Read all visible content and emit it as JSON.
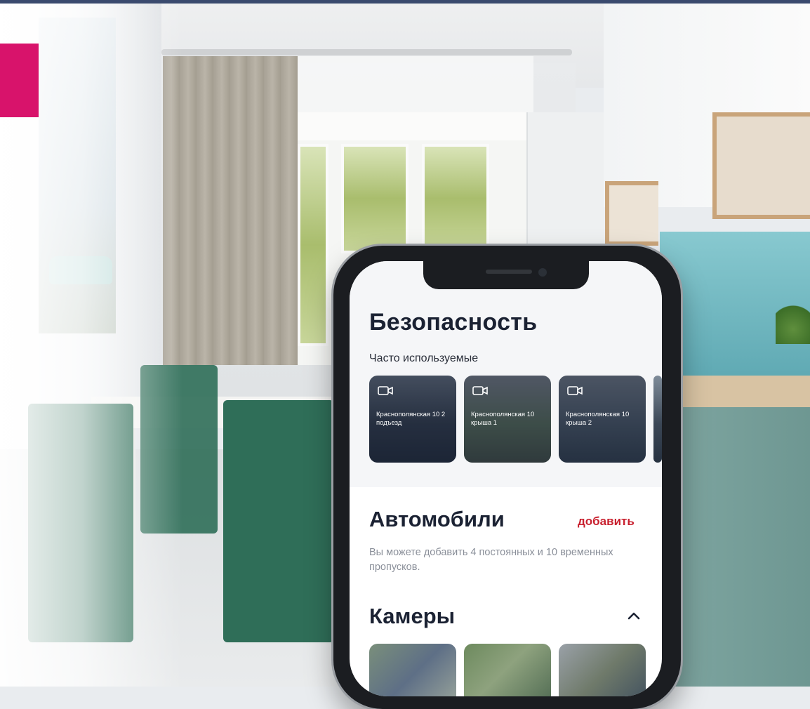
{
  "app": {
    "accent_color": "#c8202e",
    "badge_color": "#d8136b"
  },
  "security": {
    "title": "Безопасность",
    "frequent_label": "Часто используемые",
    "cameras": [
      {
        "label": "Краснополянская 10 2 подъезд",
        "icon": "video-camera-icon"
      },
      {
        "label": "Краснополянская 10 крыша 1",
        "icon": "video-camera-icon"
      },
      {
        "label": "Краснополянская 10 крыша 2",
        "icon": "video-camera-icon"
      }
    ]
  },
  "cars": {
    "title": "Автомобили",
    "add_label": "добавить",
    "note": "Вы можете добавить 4 постоянных и 10 временных пропусков."
  },
  "cameras_section": {
    "title": "Камеры",
    "collapse_icon": "chevron-up-icon"
  }
}
